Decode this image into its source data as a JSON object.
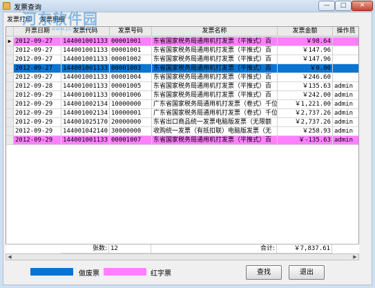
{
  "window": {
    "title": "发票查询",
    "min": "—",
    "max": "□",
    "close": "✕"
  },
  "tabs": [
    "发票打印",
    "发票明细"
  ],
  "watermark": {
    "text": "河东软件园",
    "sub": "www.pc0359.cn"
  },
  "columns": [
    "开票日期",
    "发票代码",
    "发票号码",
    "发票名称",
    "发票金额",
    "操作员"
  ],
  "rows": [
    {
      "date": "2012-09-27",
      "code": "144001001133",
      "num": "00001001",
      "name": "东省国家税务局通用机打发票（平推式）百",
      "amount": "￥98.64",
      "op": "",
      "style": "pink"
    },
    {
      "date": "2012-09-27",
      "code": "144001001133",
      "num": "00001001",
      "name": "东省国家税务局通用机打发票（平推式）百",
      "amount": "￥147.96",
      "op": "",
      "style": ""
    },
    {
      "date": "2012-09-27",
      "code": "144001001133",
      "num": "00001002",
      "name": "东省国家税务局通用机打发票（平推式）百",
      "amount": "￥147.96",
      "op": "",
      "style": ""
    },
    {
      "date": "2012-09-27",
      "code": "144001001133",
      "num": "00001003",
      "name": "东省国家税务局通用机打发票（平推式）百",
      "amount": "￥0.00",
      "op": "",
      "style": "blue"
    },
    {
      "date": "2012-09-27",
      "code": "144001001133",
      "num": "00001004",
      "name": "东省国家税务局通用机打发票（平推式）百",
      "amount": "￥246.60",
      "op": "",
      "style": ""
    },
    {
      "date": "2012-09-28",
      "code": "144001001133",
      "num": "00001005",
      "name": "东省国家税务局通用机打发票（平推式）百",
      "amount": "￥135.63",
      "op": "admin",
      "style": ""
    },
    {
      "date": "2012-09-29",
      "code": "144001001133",
      "num": "00001006",
      "name": "东省国家税务局通用机打发票（平推式）百",
      "amount": "￥242.00",
      "op": "admin",
      "style": ""
    },
    {
      "date": "2012-09-29",
      "code": "144001002134",
      "num": "10000000",
      "name": "广东省国家税务局通用机打发票（卷式）千位",
      "amount": "￥1,221.00",
      "op": "admin",
      "style": ""
    },
    {
      "date": "2012-09-29",
      "code": "144001002134",
      "num": "10000001",
      "name": "广东省国家税务局通用机打发票（卷式）千位",
      "amount": "￥2,737.26",
      "op": "admin",
      "style": ""
    },
    {
      "date": "2012-09-29",
      "code": "144001025170",
      "num": "20000000",
      "name": "东省出口商品统一发票电脑版发票（无限额",
      "amount": "￥2,737.26",
      "op": "admin",
      "style": ""
    },
    {
      "date": "2012-09-29",
      "code": "144001042140",
      "num": "30000000",
      "name": "收购统一发票（有抵扣联）电脑版发票（无",
      "amount": "￥258.93",
      "op": "admin",
      "style": ""
    },
    {
      "date": "2012-09-29",
      "code": "144001001133",
      "num": "00001007",
      "name": "东省国家税务局通用机打发票（平推式）百",
      "amount": "￥-135.63",
      "op": "admin",
      "style": "pink"
    }
  ],
  "row_indicator": "▶",
  "footer": {
    "count_label": "张数:",
    "count_value": "12",
    "total_label": "合计:",
    "total_value": "￥7,837.61"
  },
  "legend": [
    {
      "label": "做废票",
      "color": "#0a74d2"
    },
    {
      "label": "红字票",
      "color": "#ff80ff"
    }
  ],
  "buttons": {
    "search": "查找",
    "exit": "退出"
  }
}
